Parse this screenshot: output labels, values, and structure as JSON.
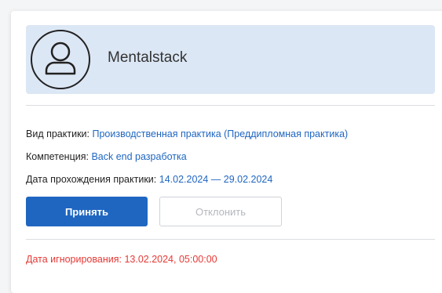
{
  "request": {
    "org_name": "Mentalstack",
    "practice_type_label": "Вид практики:",
    "practice_type_value": "Производственная практика (Преддипломная практика)",
    "competence_label": "Компетенция:",
    "competence_value": "Back end разработка",
    "dates_label": "Дата прохождения практики:",
    "dates_value": "14.02.2024 — 29.02.2024",
    "accept_label": "Принять",
    "reject_label": "Отклонить",
    "ignore_date": "Дата игнорирования: 13.02.2024, 05:00:00"
  },
  "icons": {
    "avatar": "user-icon"
  },
  "colors": {
    "accent": "#1f66c1",
    "header_bg": "#dce7f5",
    "warning": "#e53935"
  }
}
